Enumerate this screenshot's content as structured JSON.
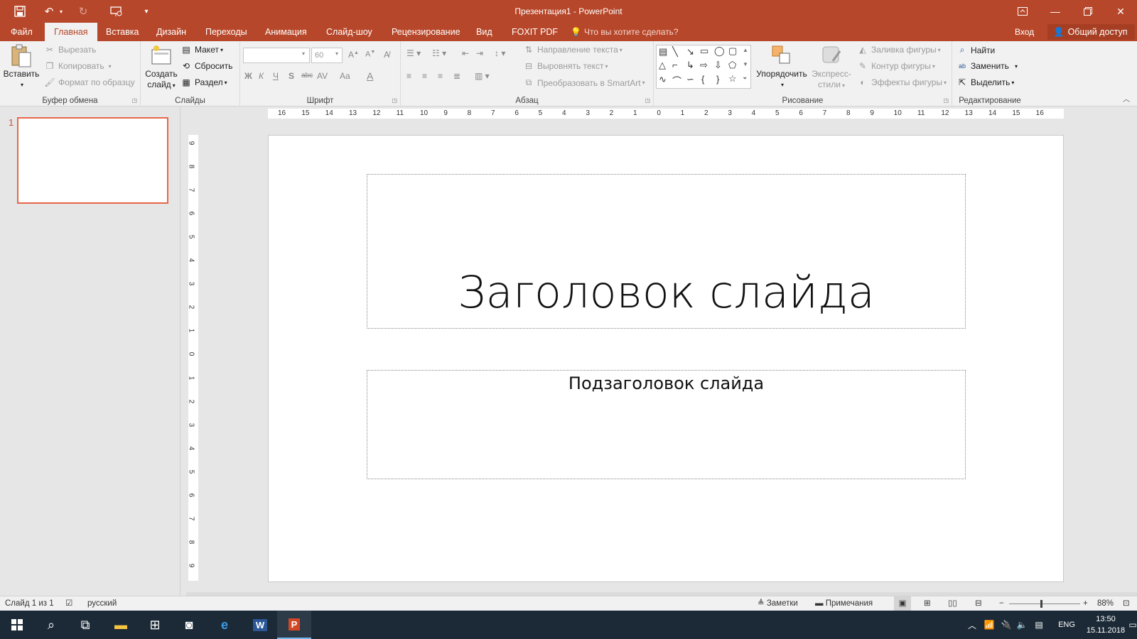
{
  "app": {
    "window_title": "Презентация1 - PowerPoint",
    "qat": {
      "save": "save-icon",
      "undo": "undo-icon",
      "redo": "redo-icon",
      "start": "slideshow-start-icon",
      "customize": "customize-qat-icon"
    }
  },
  "tabs": [
    {
      "label": "Файл"
    },
    {
      "label": "Главная"
    },
    {
      "label": "Вставка"
    },
    {
      "label": "Дизайн"
    },
    {
      "label": "Переходы"
    },
    {
      "label": "Анимация"
    },
    {
      "label": "Слайд-шоу"
    },
    {
      "label": "Рецензирование"
    },
    {
      "label": "Вид"
    },
    {
      "label": "FOXIT PDF"
    }
  ],
  "tell_me": "Что вы хотите сделать?",
  "signin": "Вход",
  "share": "Общий доступ",
  "ribbon": {
    "clipboard": {
      "label": "Буфер обмена",
      "paste": "Вставить",
      "cut": "Вырезать",
      "copy": "Копировать",
      "format_painter": "Формат по образцу"
    },
    "slides": {
      "label": "Слайды",
      "new_slide_1": "Создать",
      "new_slide_2": "слайд",
      "layout": "Макет",
      "reset": "Сбросить",
      "section": "Раздел"
    },
    "font": {
      "label": "Шрифт",
      "font_name": "",
      "font_size": "60",
      "bold": "Ж",
      "italic": "К",
      "underline": "Ч",
      "shadow": "S",
      "strike": "abc",
      "spacing": "AV",
      "case": "Aa",
      "color": "A"
    },
    "paragraph": {
      "label": "Абзац",
      "text_direction": "Направление текста",
      "align_text": "Выровнять текст",
      "smartart": "Преобразовать в SmartArt"
    },
    "drawing": {
      "label": "Рисование",
      "arrange": "Упорядочить",
      "quick_styles_1": "Экспресс-",
      "quick_styles_2": "стили",
      "shape_fill": "Заливка фигуры",
      "shape_outline": "Контур фигуры",
      "shape_effects": "Эффекты фигуры"
    },
    "editing": {
      "label": "Редактирование",
      "find": "Найти",
      "replace": "Заменить",
      "select": "Выделить"
    }
  },
  "thumbnails": [
    {
      "number": "1"
    }
  ],
  "ruler": {
    "horizontal": [
      "16",
      "15",
      "14",
      "13",
      "12",
      "11",
      "10",
      "9",
      "8",
      "7",
      "6",
      "5",
      "4",
      "3",
      "2",
      "1",
      "0",
      "1",
      "2",
      "3",
      "4",
      "5",
      "6",
      "7",
      "8",
      "9",
      "10",
      "11",
      "12",
      "13",
      "14",
      "15",
      "16"
    ],
    "vertical": [
      "9",
      "8",
      "7",
      "6",
      "5",
      "4",
      "3",
      "2",
      "1",
      "0",
      "1",
      "2",
      "3",
      "4",
      "5",
      "6",
      "7",
      "8",
      "9"
    ]
  },
  "slide": {
    "title": "Заголовок слайда",
    "subtitle": "Подзаголовок слайда"
  },
  "status": {
    "slide_count": "Слайд 1 из 1",
    "language": "русский",
    "notes": "Заметки",
    "comments": "Примечания",
    "zoom": "88%",
    "zoom_level": 0.88
  },
  "taskbar": {
    "time": "13:50",
    "date": "15.11.2018",
    "lang": "ENG"
  }
}
